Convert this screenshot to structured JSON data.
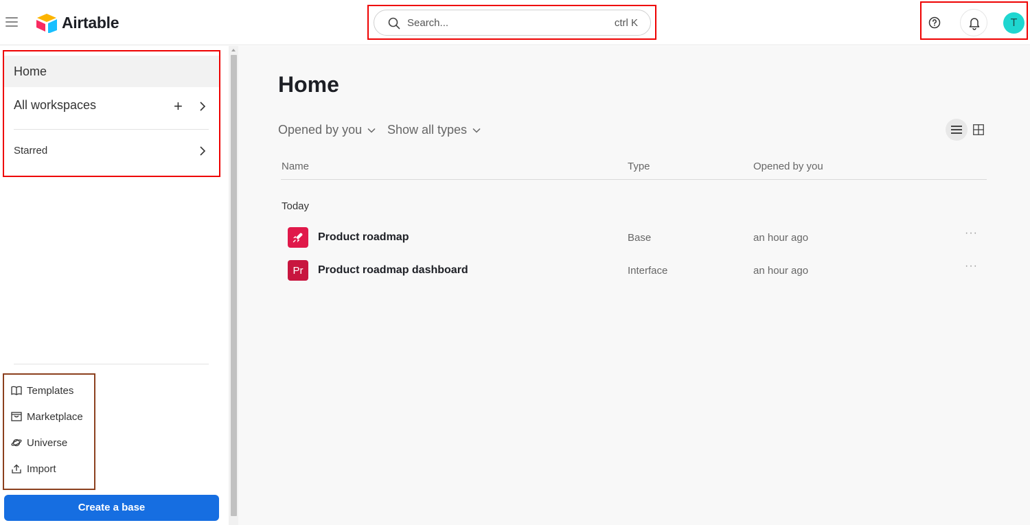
{
  "header": {
    "logo_text": "Airtable",
    "search": {
      "placeholder": "Search...",
      "shortcut": "ctrl K"
    },
    "avatar_initial": "T",
    "avatar_color": "#1fd6d0"
  },
  "sidebar": {
    "home_label": "Home",
    "workspaces_label": "All workspaces",
    "starred_label": "Starred",
    "tools": [
      {
        "label": "Templates",
        "icon": "book-icon"
      },
      {
        "label": "Marketplace",
        "icon": "marketplace-icon"
      },
      {
        "label": "Universe",
        "icon": "planet-icon"
      },
      {
        "label": "Import",
        "icon": "upload-icon"
      }
    ],
    "create_button": "Create a base"
  },
  "main": {
    "title": "Home",
    "filters": {
      "opened": "Opened by you",
      "types": "Show all types"
    },
    "columns": {
      "name": "Name",
      "type": "Type",
      "opened": "Opened by you"
    },
    "group_label": "Today",
    "rows": [
      {
        "name": "Product roadmap",
        "type": "Base",
        "opened": "an hour ago",
        "icon": "rocket-icon",
        "color": "#e0194a"
      },
      {
        "name": "Product roadmap dashboard",
        "type": "Interface",
        "opened": "an hour ago",
        "icon_text": "Pr",
        "color": "#c8163f"
      }
    ],
    "more_label": "···"
  },
  "colors": {
    "accent": "#166ee1",
    "highlight": "#e00000"
  }
}
